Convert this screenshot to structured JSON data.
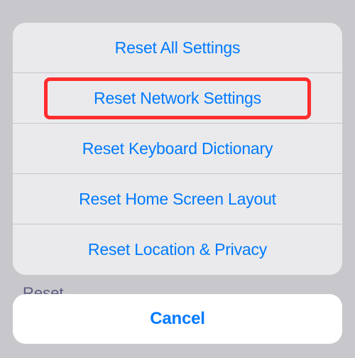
{
  "background": {
    "partial_text_bottom": "Reset"
  },
  "actionSheet": {
    "items": [
      {
        "label": "Reset All Settings"
      },
      {
        "label": "Reset Network Settings"
      },
      {
        "label": "Reset Keyboard Dictionary"
      },
      {
        "label": "Reset Home Screen Layout"
      },
      {
        "label": "Reset Location & Privacy"
      }
    ],
    "highlighted_index": 1,
    "cancel_label": "Cancel"
  },
  "colors": {
    "accent": "#007aff",
    "highlight": "#ff2d2d",
    "sheet_bg": "#eaeaec",
    "cancel_bg": "#ffffff",
    "backdrop": "#c8c8cc"
  }
}
